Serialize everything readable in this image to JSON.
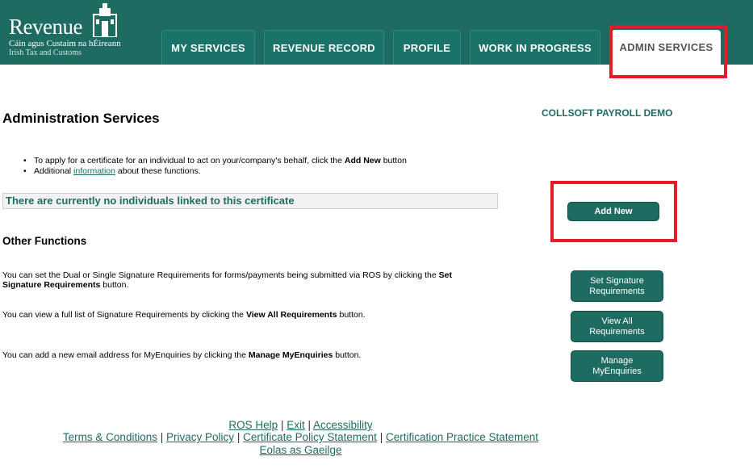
{
  "brand": {
    "name": "Revenue",
    "subtitle_irish": "Cáin agus Custaim na hÉireann",
    "subtitle_english": "Irish Tax and Customs"
  },
  "tabs": [
    {
      "label": "MY SERVICES"
    },
    {
      "label": "REVENUE RECORD"
    },
    {
      "label": "PROFILE"
    },
    {
      "label": "WORK IN PROGRESS"
    },
    {
      "label": "ADMIN SERVICES"
    }
  ],
  "page_title": "Administration Services",
  "company_name": "COLLSOFT PAYROLL DEMO",
  "info": {
    "item1_pre": "To apply for a certificate for an individual to act on your/company's behalf, click the ",
    "item1_bold": "Add New",
    "item1_post": " button",
    "item2_pre": "Additional ",
    "item2_link": "information",
    "item2_post": " about these functions."
  },
  "no_individuals_text": "There are currently no individuals linked to this certificate",
  "add_new_label": "Add New",
  "other_functions_title": "Other Functions",
  "functions": [
    {
      "pre": "You can set the Dual or Single Signature Requirements for forms/payments being submitted via ROS by clicking the ",
      "bold": "Set Signature Requirements",
      "post": " button.",
      "button_line1": "Set Signature",
      "button_line2": "Requirements"
    },
    {
      "pre": "You can view a full list of Signature Requirements by clicking the ",
      "bold": "View All Requirements",
      "post": " button.",
      "button_line1": "View All",
      "button_line2": "Requirements"
    },
    {
      "pre": "You can add a new email address for MyEnquiries by clicking the ",
      "bold": "Manage MyEnquiries",
      "post": " button.",
      "button_line1": "Manage",
      "button_line2": "MyEnquiries"
    }
  ],
  "footer": {
    "ros_help": "ROS Help",
    "exit": "Exit",
    "accessibility": "Accessibility",
    "terms": "Terms & Conditions",
    "privacy": "Privacy Policy",
    "cert_policy": "Certificate Policy Statement",
    "cert_practice": "Certification Practice Statement",
    "irish": "Eolas as Gaeilge",
    "separator": "|"
  },
  "colors": {
    "header_bg": "#1e6b62",
    "highlight": "#e01e27",
    "button_bg": "#1e6b62"
  }
}
